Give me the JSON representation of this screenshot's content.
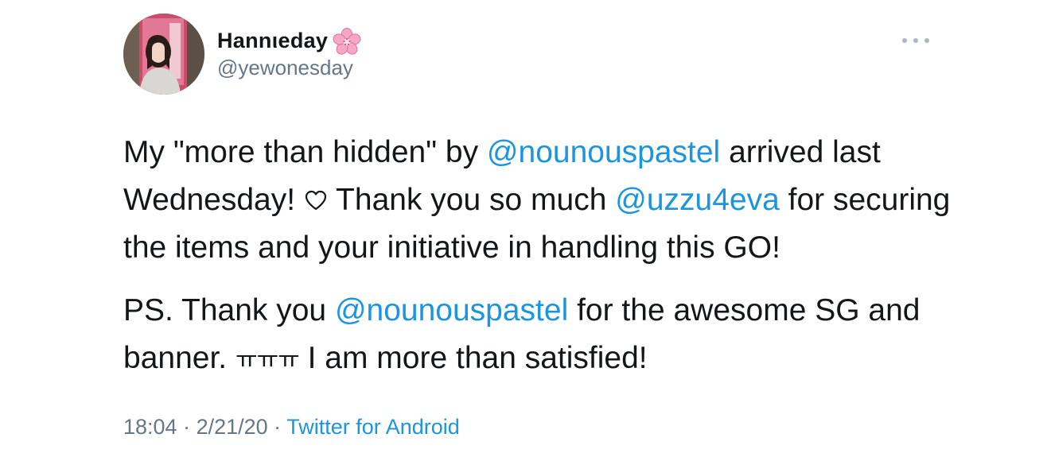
{
  "user": {
    "display_name": "Hannιeday",
    "name_emoji_icon": "cherry-blossom-icon",
    "handle": "@yewonesday"
  },
  "actions": {
    "more_icon": "more-dots-icon"
  },
  "tweet": {
    "p1": {
      "t1": "My \"more than hidden\" by ",
      "m1": "@nounouspastel",
      "t2": " arrived last Wednesday! ",
      "heart_icon": "heart-outline-icon",
      "t3": " Thank you so much ",
      "m2": "@uzzu4eva",
      "t4": " for securing the items and your initiative in handling this GO!"
    },
    "p2": {
      "t1": "PS. Thank you ",
      "m1": "@nounouspastel",
      "t2": " for the awesome SG and banner. ",
      "tt": "ㅠㅠㅠ",
      "t3": " I am more than satisfied!"
    }
  },
  "meta": {
    "time": "18:04",
    "sep1": " · ",
    "date": "2/21/20",
    "sep2": " · ",
    "source": "Twitter for Android"
  },
  "colors": {
    "link": "#1b95e0",
    "secondary": "#657786",
    "text": "#14171a"
  }
}
